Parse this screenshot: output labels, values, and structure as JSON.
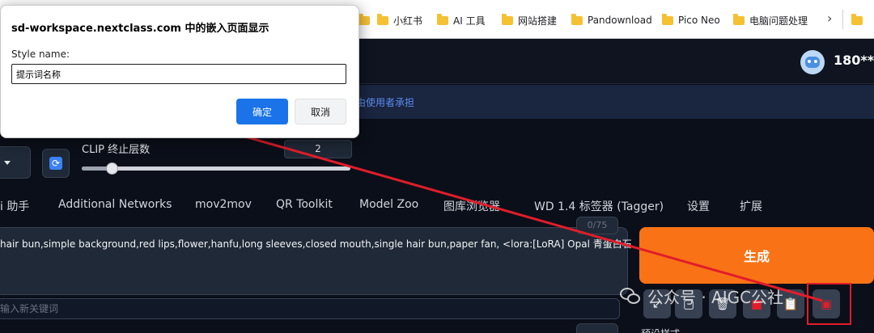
{
  "bookmarks": {
    "items": [
      {
        "label": "小红书"
      },
      {
        "label": "AI 工具"
      },
      {
        "label": "网站搭建"
      },
      {
        "label": "Pandownload"
      },
      {
        "label": "Pico Neo"
      },
      {
        "label": "电脑问题处理"
      }
    ],
    "more_glyph": "›"
  },
  "header": {
    "username": "180***"
  },
  "notice": {
    "text": "将由使用者承担"
  },
  "settings": {
    "clip_label": "CLIP 终止层数",
    "clip_value": "2",
    "clip_slider_fraction": 0.11
  },
  "tabs": [
    {
      "label": "i 助手"
    },
    {
      "label": "Additional Networks"
    },
    {
      "label": "mov2mov"
    },
    {
      "label": "QR Toolkit"
    },
    {
      "label": "Model Zoo"
    },
    {
      "label": "图库浏览器"
    },
    {
      "label": "WD 1.4 标签器 (Tagger)"
    },
    {
      "label": "设置"
    },
    {
      "label": "扩展"
    }
  ],
  "prompt": {
    "text": "hair bun,simple background,red lips,flower,hanfu,long sleeves,closed mouth,single hair bun,paper fan, <lora:[LoRA] Opal  青蛋白石",
    "token_count": "0/75",
    "negative_placeholder": "输入新关键词"
  },
  "generate": {
    "label": "生成"
  },
  "toolbar": {
    "icons": [
      "arrow-icon",
      "copy-icon",
      "trash-icon",
      "book-icon",
      "clipboard-icon",
      "save-style-icon"
    ]
  },
  "preset": {
    "label": "预设样式"
  },
  "watermark": {
    "text": "公众号 · AIGC公社"
  },
  "dialog": {
    "title": "sd-workspace.nextclass.com 中的嵌入页面显示",
    "label": "Style name:",
    "input_value": "提示词名称",
    "ok_label": "确定",
    "cancel_label": "取消"
  },
  "colors": {
    "annotation_red": "#e11d2a",
    "generate_orange": "#f97316",
    "dialog_ok_blue": "#1a73e8"
  }
}
